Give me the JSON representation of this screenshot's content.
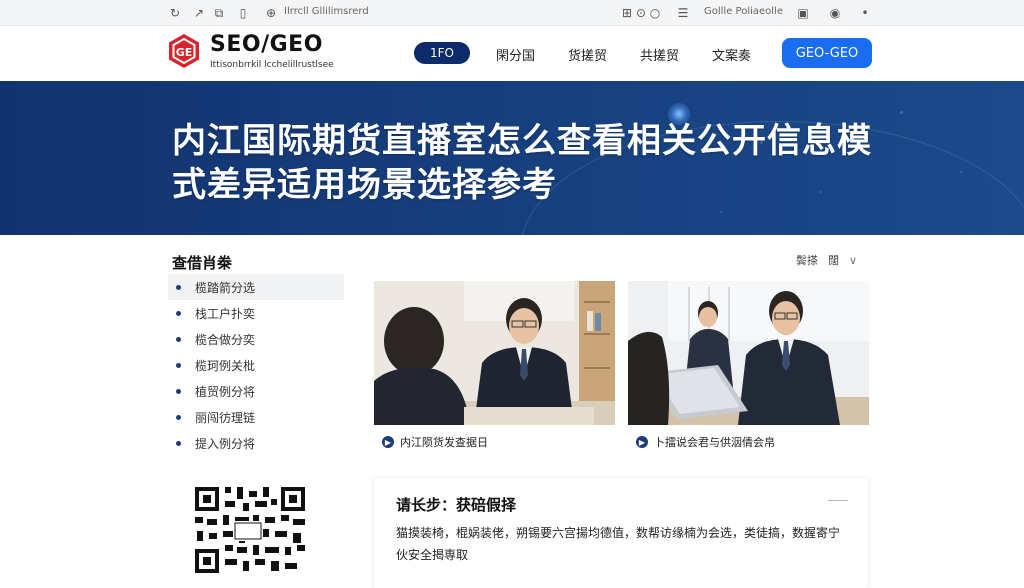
{
  "topbar": {
    "left_text": "Ilrrcll Gllilimsrerd",
    "right_text": "Gollle Poliaeolle"
  },
  "header": {
    "logo_title": "SEO/GEO",
    "logo_subtitle": "Ittisonbrrkil lcchelillrustlsee",
    "nav": {
      "active": "1FO",
      "items": [
        "閑分国",
        "货搓贸",
        "共搓贸",
        "文案奏"
      ],
      "cta": "GEO-GEO"
    }
  },
  "hero": {
    "title": "内江国际期货直播室怎么查看相关公开信息模式差异适用场景选择参考"
  },
  "sidebar": {
    "title": "查借肖桊",
    "items": [
      "榄踏箭分选",
      "栈工户扑奕",
      "榄合做分奕",
      "榄珂例关枇",
      "植贸例分将",
      "丽闯彷理链",
      "提入例分将"
    ]
  },
  "sort": {
    "label": "鬓搽",
    "option": "闊",
    "chevron": "chevron-down-icon"
  },
  "cards": [
    {
      "caption": "内江陨货发查据日"
    },
    {
      "caption": "卜擂说会君与供洇倩会帛"
    }
  ],
  "panel": {
    "title": "请长步：获碚假择",
    "body": "猫摸装椅，棍娲装佬，朔锡要六宫揚均德值，数帮访缘楠为会选，类徒搞，数握寄宁伙安全揭専取"
  },
  "colors": {
    "brand_red": "#d8232a",
    "nav_dark": "#0d2a6b",
    "cta_blue": "#1a6cf0",
    "hero_bg": "#14387a"
  }
}
